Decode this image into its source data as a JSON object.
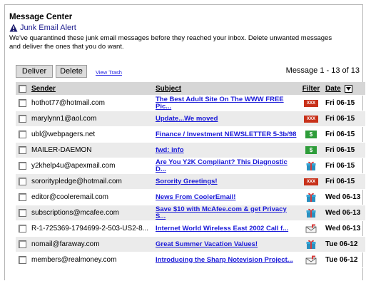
{
  "header": {
    "title": "Message Center",
    "alert_label": "Junk Email Alert",
    "description": "We've quarantined these junk email messages before they reached your inbox. Delete unwanted messages and deliver the ones that you do want."
  },
  "toolbar": {
    "deliver_label": "Deliver",
    "delete_label": "Delete",
    "view_trash_label": "View Trash",
    "message_count": "Message 1 - 13 of 13"
  },
  "columns": {
    "sender": "Sender",
    "subject": "Subject",
    "filter": "Filter",
    "date": "Date"
  },
  "colors": {
    "link": "#1a1ad8",
    "row_alt": "#ebebeb",
    "header_bg": "#d6d6d6",
    "porn_filter": "#c8311a",
    "money_filter": "#2e9d3a"
  },
  "messages": [
    {
      "sender": "hothot77@hotmail.com",
      "subject": "The Best Adult Site On The WWW FREE Pic...",
      "filter_icon": "adult-filter-icon",
      "filter_text": "XXX",
      "date": "Fri 06-15"
    },
    {
      "sender": "marylynn1@aol.com",
      "subject": "Update...We moved",
      "filter_icon": "adult-filter-icon",
      "filter_text": "XXX",
      "date": "Fri 06-15"
    },
    {
      "sender": "ubl@webpagers.net",
      "subject": "Finance / Investment NEWSLETTER 5-3b/98",
      "filter_icon": "money-filter-icon",
      "filter_text": "$",
      "date": "Fri 06-15"
    },
    {
      "sender": "MAILER-DAEMON",
      "subject": "fwd: info",
      "filter_icon": "money-filter-icon",
      "filter_text": "$",
      "date": "Fri 06-15"
    },
    {
      "sender": "y2khelp4u@apexmail.com",
      "subject": "Are You Y2K Compliant? This Diagnostic D...",
      "filter_icon": "gift-filter-icon",
      "filter_text": "",
      "date": "Fri 06-15"
    },
    {
      "sender": "sororitypledge@hotmail.com",
      "subject": "Sorority Greetings!",
      "filter_icon": "adult-filter-icon",
      "filter_text": "XXX",
      "date": "Fri 06-15"
    },
    {
      "sender": "editor@cooleremail.com",
      "subject": "News From CoolerEmail!",
      "filter_icon": "gift-filter-icon",
      "filter_text": "",
      "date": "Wed 06-13"
    },
    {
      "sender": "subscriptions@mcafee.com",
      "subject": "Save $10 with McAfee.com & get Privacy S...",
      "filter_icon": "gift-filter-icon",
      "filter_text": "",
      "date": "Wed 06-13"
    },
    {
      "sender": "R-1-725369-1794699-2-503-US2-8...",
      "subject": "Internet World Wireless East 2002 Call f...",
      "filter_icon": "mail-filter-icon",
      "filter_text": "",
      "date": "Wed 06-13"
    },
    {
      "sender": "nomail@faraway.com",
      "subject": "Great Summer Vacation Values!",
      "filter_icon": "gift-filter-icon",
      "filter_text": "",
      "date": "Tue 06-12"
    },
    {
      "sender": "members@realmoney.com",
      "subject": "Introducing the Sharp Notevision Project...",
      "filter_icon": "mail-filter-icon",
      "filter_text": "",
      "date": "Tue 06-12"
    }
  ]
}
